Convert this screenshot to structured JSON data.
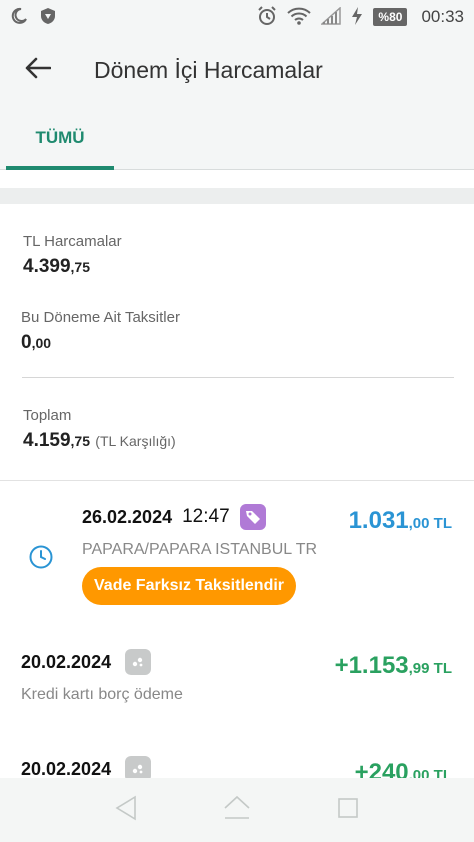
{
  "status_bar": {
    "battery": "%80",
    "time": "00:33"
  },
  "header": {
    "title": "Dönem İçi Harcamalar"
  },
  "tabs": [
    {
      "label": "TÜMÜ",
      "selected": true
    }
  ],
  "summary": {
    "tl_spending_label": "TL Harcamalar",
    "tl_spending_int": "4.399",
    "tl_spending_cents": ",75",
    "installments_label": "Bu Döneme Ait Taksitler",
    "installments_int": "0",
    "installments_cents": ",00",
    "total_label": "Toplam",
    "total_int": "4.159",
    "total_cents": ",75",
    "total_suffix": "(TL Karşılığı)"
  },
  "transactions": [
    {
      "date": "26.02.2024",
      "time": "12:47",
      "description": "PAPARA/PAPARA ISTANBUL TR",
      "amount_int": "1.031",
      "amount_cents": ",00 TL",
      "action_label": "Vade Farksız Taksitlendir"
    },
    {
      "date": "20.02.2024",
      "description": "Kredi kartı borç ödeme",
      "amount_int": "+1.153",
      "amount_cents": ",99 TL"
    },
    {
      "date": "20.02.2024",
      "amount_int": "+240",
      "amount_cents": ",00 TL"
    }
  ],
  "colors": {
    "accent": "#1f8a6f",
    "amount_blue": "#2a94d4",
    "amount_green": "#2aa160",
    "orange": "#ff9800",
    "tag_purple": "#b07ad6"
  }
}
